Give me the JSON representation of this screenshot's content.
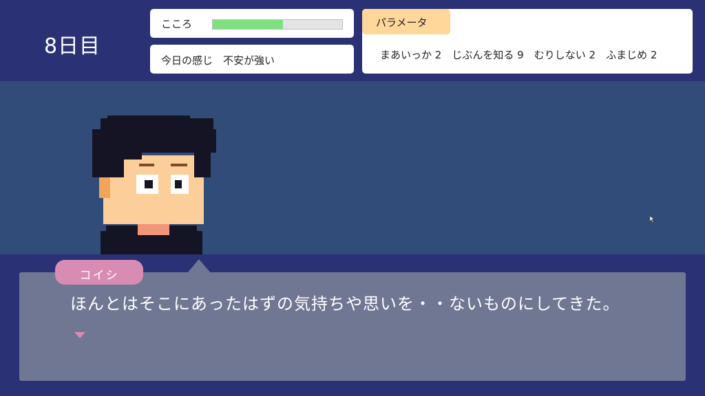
{
  "hud": {
    "day": "8日目",
    "kokoro": {
      "label": "こころ",
      "level": 0.54
    },
    "mood": {
      "label": "今日の感じ",
      "value": "不安が強い"
    },
    "parameters": {
      "title": "パラメータ",
      "items": [
        {
          "name": "まあいっか",
          "value": 2
        },
        {
          "name": "じぶんを知る",
          "value": 9
        },
        {
          "name": "むりしない",
          "value": 2
        },
        {
          "name": "ふまじめ",
          "value": 2
        }
      ]
    }
  },
  "dialogue": {
    "speaker": "コイシ",
    "text": "ほんとはそこにあったはずの気持ちや思いを・・ないものにしてきた。"
  },
  "colors": {
    "header_bg": "#2a3174",
    "scene_bg": "#324c7a",
    "textbox_bg": "#707792",
    "nameplate": "#d88cb3",
    "params_tab": "#ffd79a",
    "kokoro_fill": "#7fe07f"
  }
}
